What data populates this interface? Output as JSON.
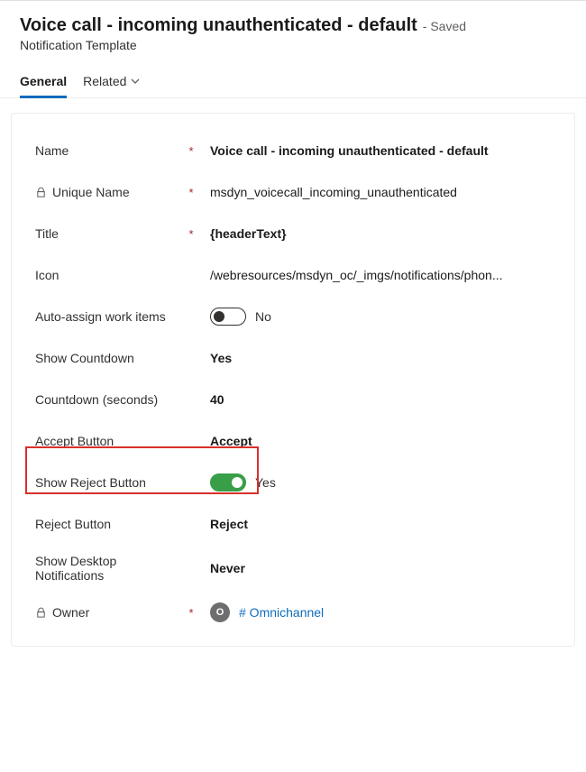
{
  "header": {
    "title": "Voice call - incoming unauthenticated - default",
    "saved": "- Saved",
    "subtitle": "Notification Template"
  },
  "tabs": {
    "general": "General",
    "related": "Related"
  },
  "fields": {
    "name": {
      "label": "Name",
      "value": "Voice call - incoming unauthenticated - default"
    },
    "unique_name": {
      "label": "Unique Name",
      "value": "msdyn_voicecall_incoming_unauthenticated"
    },
    "title": {
      "label": "Title",
      "value": "{headerText}"
    },
    "icon": {
      "label": "Icon",
      "value": "/webresources/msdyn_oc/_imgs/notifications/phon..."
    },
    "auto_assign": {
      "label": "Auto-assign work items",
      "value_label": "No"
    },
    "show_countdown": {
      "label": "Show Countdown",
      "value": "Yes"
    },
    "countdown": {
      "label": "Countdown (seconds)",
      "value": "40"
    },
    "accept_button": {
      "label": "Accept Button",
      "value": "Accept"
    },
    "show_reject": {
      "label": "Show Reject Button",
      "value_label": "Yes"
    },
    "reject_button": {
      "label": "Reject Button",
      "value": "Reject"
    },
    "show_desktop": {
      "label": "Show Desktop Notifications",
      "value": "Never"
    },
    "owner": {
      "label": "Owner",
      "initial": "O",
      "link_text": "# Omnichannel"
    }
  }
}
